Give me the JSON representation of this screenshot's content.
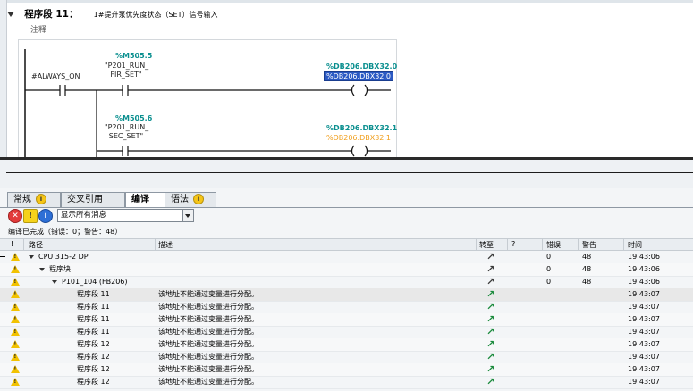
{
  "network": {
    "title": "程序段 11：",
    "description": "1#提升泵优先度状态（SET）信号输入",
    "comment_label": "注释"
  },
  "ladder": {
    "power_input": "#ALWAYS_ON",
    "contact1": {
      "address": "%M505.5",
      "tag_line1": "\"P201_RUN_",
      "tag_line2": "FIR_SET\""
    },
    "contact2": {
      "address": "%M505.6",
      "tag_line1": "\"P201_RUN_",
      "tag_line2": "SEC_SET\""
    },
    "coil1": {
      "address": "%DB206.DBX32.0",
      "operand": "%DB206.DBX32.0"
    },
    "coil2": {
      "address": "%DB206.DBX32.1",
      "operand": "%DB206.DBX32.1"
    }
  },
  "inspector": {
    "tabs": [
      {
        "label": "常规"
      },
      {
        "label": "交叉引用"
      },
      {
        "label": "编译"
      },
      {
        "label": "语法"
      }
    ],
    "filter": {
      "err": "✕",
      "warn": "!",
      "info": "i",
      "selected": "显示所有消息"
    },
    "status": "编译已完成（错误：0；警告：48）",
    "columns": {
      "excl": "!",
      "path": "路径",
      "desc": "描述",
      "goto": "转至",
      "q": "?",
      "errors": "错误",
      "warnings": "警告",
      "time": "时间"
    },
    "rows": [
      {
        "path": "CPU 315-2 DP",
        "desc": "",
        "errors": "0",
        "warnings": "48",
        "time": "19:43:06"
      },
      {
        "path": "程序块",
        "desc": "",
        "errors": "0",
        "warnings": "48",
        "time": "19:43:06"
      },
      {
        "path": "P101_104 (FB206)",
        "desc": "",
        "errors": "0",
        "warnings": "48",
        "time": "19:43:06"
      },
      {
        "path": "程序段 11",
        "desc": "该地址不能通过变量进行分配。",
        "errors": "",
        "warnings": "",
        "time": "19:43:07"
      },
      {
        "path": "程序段 11",
        "desc": "该地址不能通过变量进行分配。",
        "errors": "",
        "warnings": "",
        "time": "19:43:07"
      },
      {
        "path": "程序段 11",
        "desc": "该地址不能通过变量进行分配。",
        "errors": "",
        "warnings": "",
        "time": "19:43:07"
      },
      {
        "path": "程序段 11",
        "desc": "该地址不能通过变量进行分配。",
        "errors": "",
        "warnings": "",
        "time": "19:43:07"
      },
      {
        "path": "程序段 12",
        "desc": "该地址不能通过变量进行分配。",
        "errors": "",
        "warnings": "",
        "time": "19:43:07"
      },
      {
        "path": "程序段 12",
        "desc": "该地址不能通过变量进行分配。",
        "errors": "",
        "warnings": "",
        "time": "19:43:07"
      },
      {
        "path": "程序段 12",
        "desc": "该地址不能通过变量进行分配。",
        "errors": "",
        "warnings": "",
        "time": "19:43:07"
      },
      {
        "path": "程序段 12",
        "desc": "该地址不能通过变量进行分配。",
        "errors": "",
        "warnings": "",
        "time": "19:43:07"
      }
    ]
  }
}
